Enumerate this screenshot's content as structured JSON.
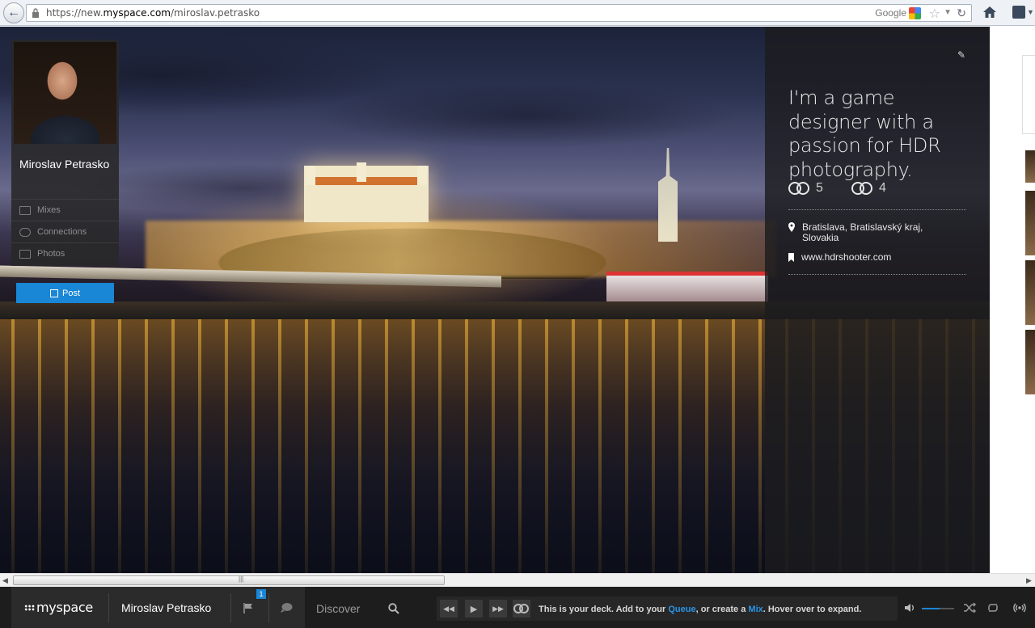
{
  "browser": {
    "url_prefix": "https://new.",
    "url_domain": "myspace.com",
    "url_path": "/miroslav.petrasko",
    "search_engine": "Google"
  },
  "profile": {
    "name": "Miroslav Petrasko",
    "nav": [
      {
        "label": "Mixes",
        "icon": "mixes-icon"
      },
      {
        "label": "Connections",
        "icon": "connections-icon"
      },
      {
        "label": "Photos",
        "icon": "photos-icon"
      }
    ],
    "post_label": "Post"
  },
  "info": {
    "bio": "I'm a game designer with a passion for HDR photography.",
    "connections_count": "5",
    "connected_count": "4",
    "location": "Bratislava, Bratislavský kraj, Slovakia",
    "website": "www.hdrshooter.com"
  },
  "deck": {
    "logo": "myspace",
    "user": "Miroslav Petrasko",
    "notification_count": "1",
    "discover": "Discover",
    "message_start": "This is your deck. Add to your ",
    "message_queue": "Queue",
    "message_mid": ", or create a ",
    "message_mix": "Mix",
    "message_end": ". Hover over to expand.",
    "volume_fraction": 0.55
  },
  "colors": {
    "accent": "#1a86d6",
    "deck_bg": "#1d1d1d"
  }
}
